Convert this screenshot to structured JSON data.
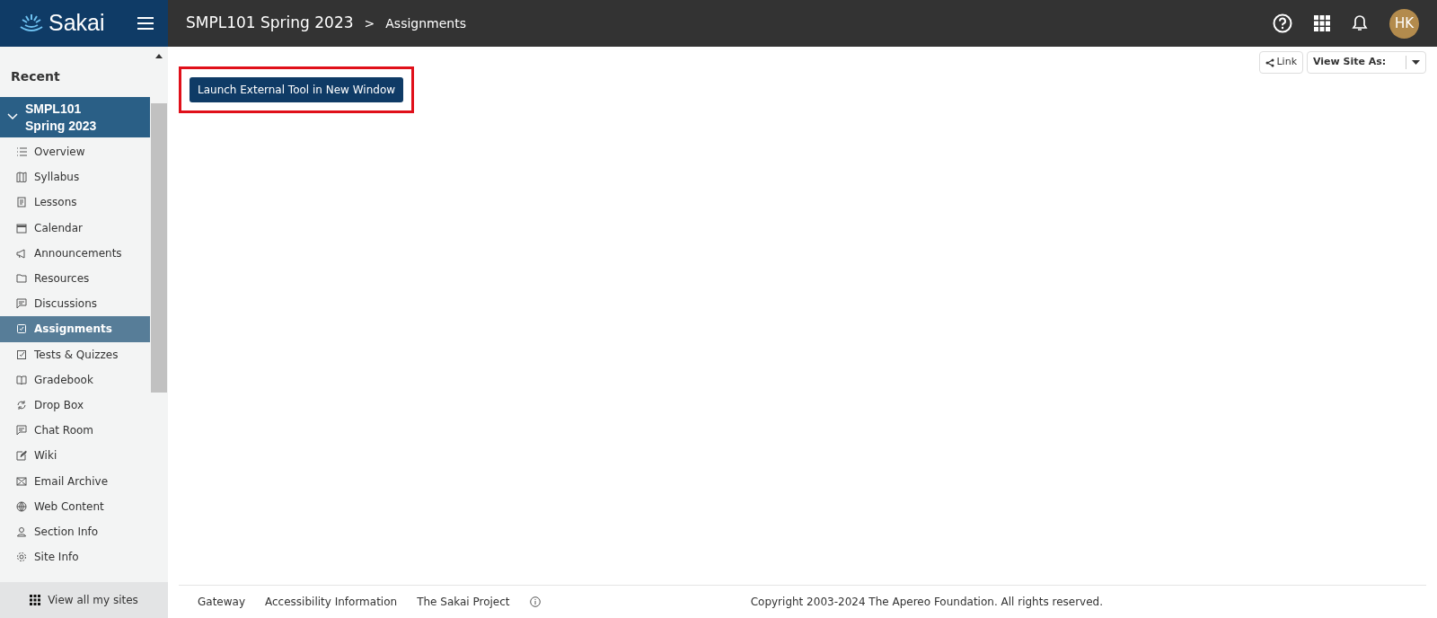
{
  "header": {
    "logo": "Sakai",
    "site": "SMPL101 Spring 2023",
    "separator": ">",
    "tool": "Assignments",
    "avatar": "HK"
  },
  "sidebar": {
    "section": "Recent",
    "site": {
      "name": "SMPL101 Spring 2023",
      "expanded": true
    },
    "items": [
      {
        "label": "Overview",
        "selected": false
      },
      {
        "label": "Syllabus",
        "selected": false
      },
      {
        "label": "Lessons",
        "selected": false
      },
      {
        "label": "Calendar",
        "selected": false
      },
      {
        "label": "Announcements",
        "selected": false
      },
      {
        "label": "Resources",
        "selected": false
      },
      {
        "label": "Discussions",
        "selected": false
      },
      {
        "label": "Assignments",
        "selected": true
      },
      {
        "label": "Tests & Quizzes",
        "selected": false
      },
      {
        "label": "Gradebook",
        "selected": false
      },
      {
        "label": "Drop Box",
        "selected": false
      },
      {
        "label": "Chat Room",
        "selected": false
      },
      {
        "label": "Wiki",
        "selected": false
      },
      {
        "label": "Email Archive",
        "selected": false
      },
      {
        "label": "Web Content",
        "selected": false
      },
      {
        "label": "Section Info",
        "selected": false
      },
      {
        "label": "Site Info",
        "selected": false
      }
    ],
    "view_all": "View all my sites"
  },
  "toolbar": {
    "link": "Link",
    "view_site_as": "View Site As:"
  },
  "content": {
    "launch_button": "Launch External Tool in New Window",
    "highlighted": true
  },
  "footer": {
    "links": [
      "Gateway",
      "Accessibility Information",
      "The Sakai Project"
    ],
    "copyright": "Copyright 2003-2024 The Apereo Foundation. All rights reserved."
  }
}
